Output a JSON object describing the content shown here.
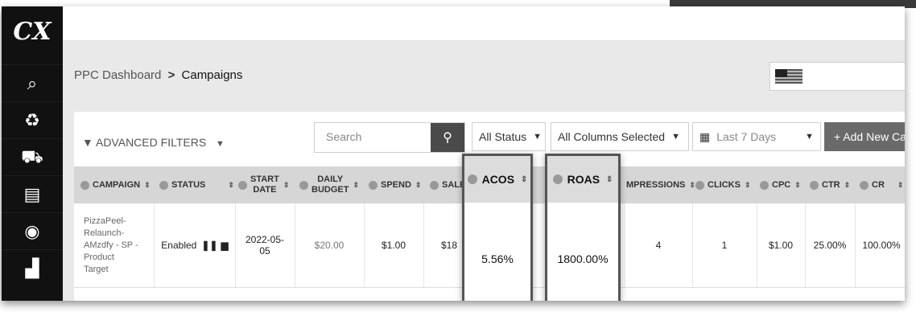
{
  "sidebar": {
    "logo": "CX",
    "items": [
      {
        "icon": "analytics-icon",
        "glyph": "⌕"
      },
      {
        "icon": "recycle-icon",
        "glyph": "♻"
      },
      {
        "icon": "cart-icon",
        "glyph": "⛟"
      },
      {
        "icon": "clipboard-icon",
        "glyph": "▤"
      },
      {
        "icon": "search-eye-icon",
        "glyph": "◉"
      },
      {
        "icon": "bar-chart-icon",
        "glyph": "▟"
      }
    ]
  },
  "breadcrumb": {
    "root": "PPC Dashboard",
    "separator": ">",
    "current": "Campaigns"
  },
  "toolbar": {
    "advanced_filters": "ADVANCED FILTERS",
    "search_placeholder": "Search",
    "status_filter": "All Status",
    "columns_filter": "All Columns Selected",
    "date_range": "Last 7 Days",
    "add_button": "+ Add New Ca"
  },
  "table": {
    "headers": {
      "campaign": "CAMPAIGN",
      "status": "STATUS",
      "start_date_1": "START",
      "start_date_2": "DATE",
      "daily_budget_1": "DAILY",
      "daily_budget_2": "BUDGET",
      "spend": "SPEND",
      "sales": "SALE",
      "acos": "ACOS",
      "roas": "ROAS",
      "impressions": "MPRESSIONS",
      "clicks": "CLICKS",
      "cpc": "CPC",
      "ctr": "CTR",
      "cr": "CR"
    },
    "rows": [
      {
        "campaign_lines": [
          "PizzaPeel-",
          "Relaunch-",
          "AMzdfy - SP -",
          "Product",
          "Target"
        ],
        "status": "Enabled",
        "start_date": "2022-05-05",
        "daily_budget": "$20.00",
        "spend": "$1.00",
        "sales": "$18",
        "acos": "5.56%",
        "roas": "1800.00%",
        "impressions": "4",
        "clicks": "1",
        "cpc": "$1.00",
        "ctr": "25.00%",
        "cr": "100.00%"
      }
    ]
  },
  "colors": {
    "sidebar": "#111111",
    "content_bg": "#e9e9e9",
    "header_bg": "#d6d6d6",
    "highlight_border": "#555555"
  }
}
